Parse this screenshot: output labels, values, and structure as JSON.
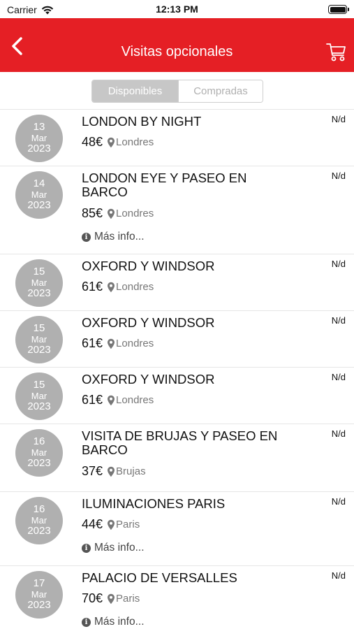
{
  "status_bar": {
    "carrier": "Carrier",
    "time": "12:13 PM"
  },
  "nav": {
    "title": "Visitas opcionales",
    "back_icon": "chevron-left-icon",
    "cart_icon": "cart-icon"
  },
  "segment": {
    "available": "Disponibles",
    "purchased": "Compradas"
  },
  "colors": {
    "brand_red": "#e51f25",
    "badge_gray": "#b0b0b0"
  },
  "tours": [
    {
      "day": "13",
      "month": "Mar",
      "year": "2023",
      "name": "LONDON BY NIGHT",
      "price": "48€",
      "city": "Londres",
      "availability": "N/d",
      "info": ""
    },
    {
      "day": "14",
      "month": "Mar",
      "year": "2023",
      "name": "LONDON EYE Y PASEO EN BARCO",
      "price": "85€",
      "city": "Londres",
      "availability": "N/d",
      "info": "Más info..."
    },
    {
      "day": "15",
      "month": "Mar",
      "year": "2023",
      "name": "OXFORD Y WINDSOR",
      "price": "61€",
      "city": "Londres",
      "availability": "N/d",
      "info": ""
    },
    {
      "day": "15",
      "month": "Mar",
      "year": "2023",
      "name": "OXFORD Y WINDSOR",
      "price": "61€",
      "city": "Londres",
      "availability": "N/d",
      "info": ""
    },
    {
      "day": "15",
      "month": "Mar",
      "year": "2023",
      "name": "OXFORD Y WINDSOR",
      "price": "61€",
      "city": "Londres",
      "availability": "N/d",
      "info": ""
    },
    {
      "day": "16",
      "month": "Mar",
      "year": "2023",
      "name": "VISITA DE BRUJAS Y PASEO EN BARCO",
      "price": "37€",
      "city": "Brujas",
      "availability": "N/d",
      "info": ""
    },
    {
      "day": "16",
      "month": "Mar",
      "year": "2023",
      "name": "ILUMINACIONES PARIS",
      "price": "44€",
      "city": "Paris",
      "availability": "N/d",
      "info": "Más info..."
    },
    {
      "day": "17",
      "month": "Mar",
      "year": "2023",
      "name": "PALACIO DE VERSALLES",
      "price": "70€",
      "city": "Paris",
      "availability": "N/d",
      "info": "Más info..."
    }
  ]
}
